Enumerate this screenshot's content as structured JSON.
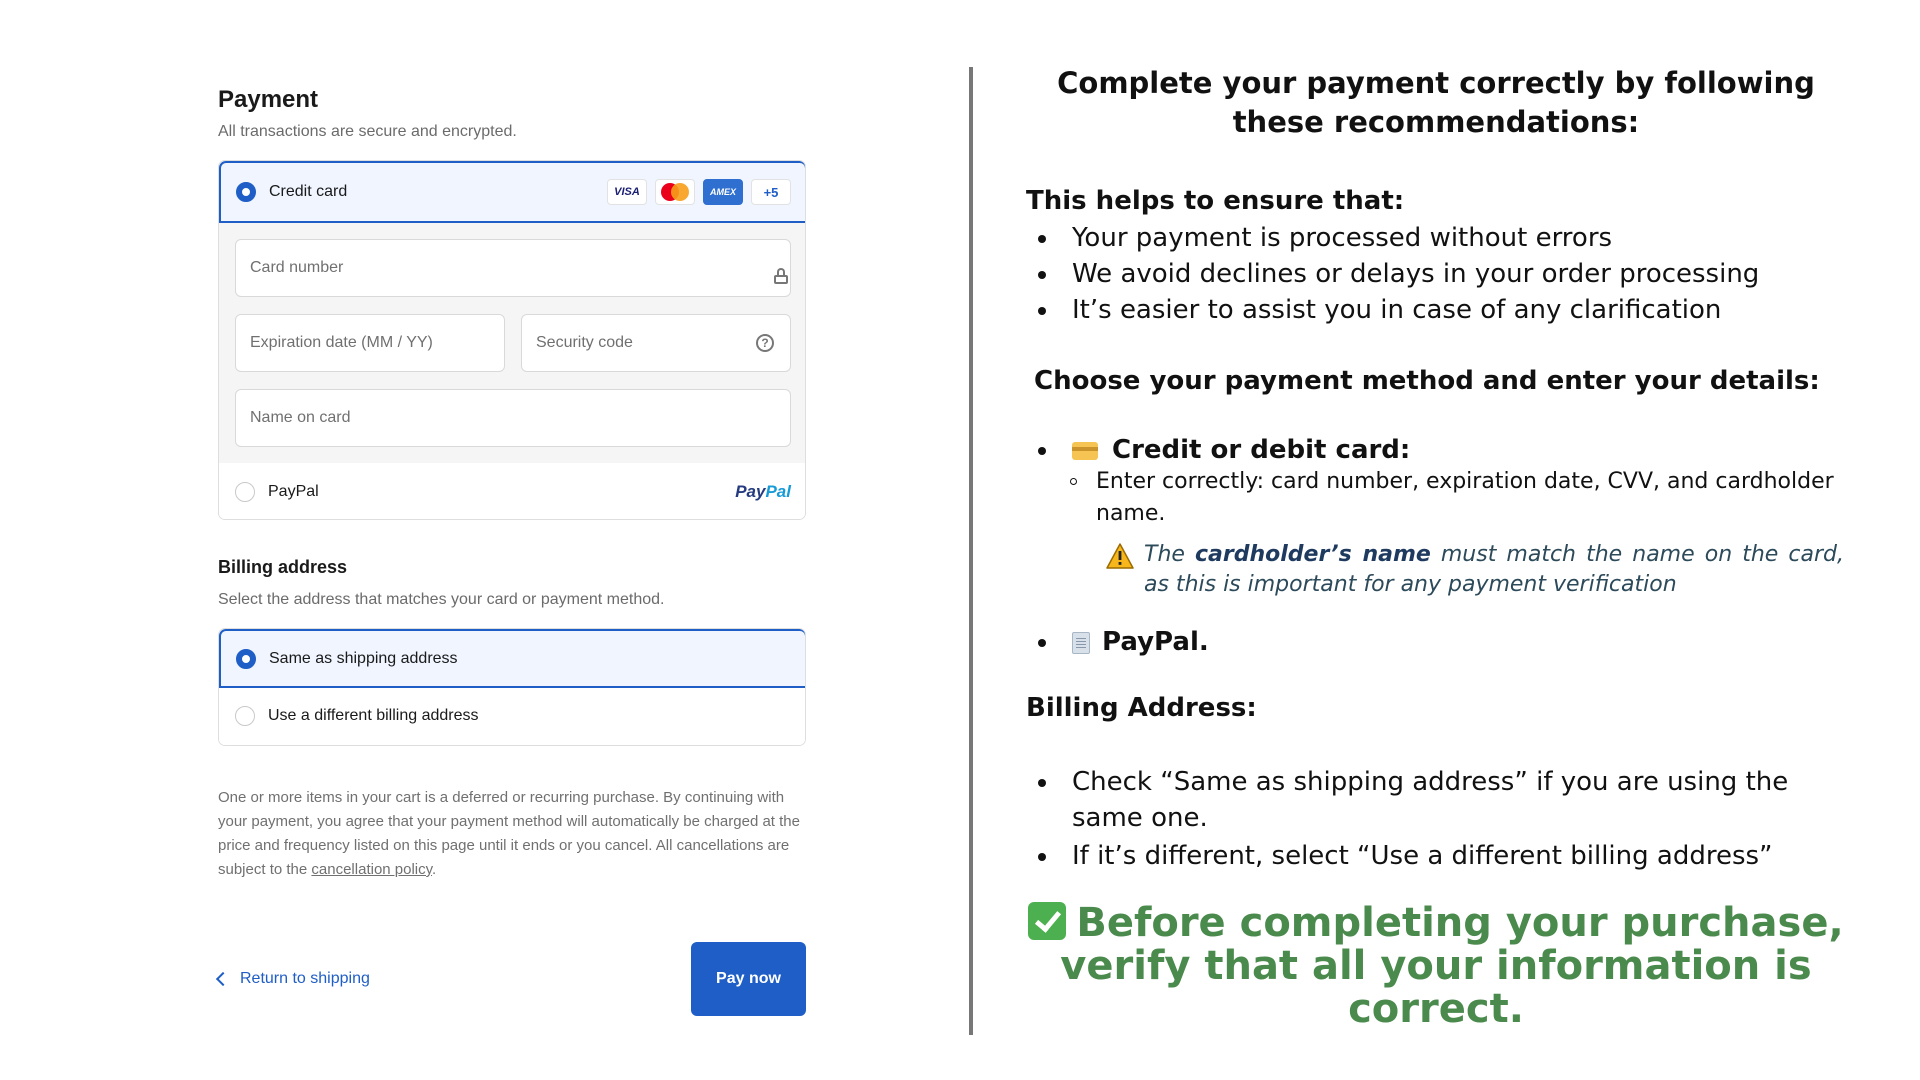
{
  "payment": {
    "title": "Payment",
    "subtitle": "All transactions are secure and encrypted.",
    "credit_card": {
      "label": "Credit card",
      "selected": true,
      "brands": [
        "VISA",
        "AMEX",
        "+5"
      ],
      "fields": {
        "card_number": "Card number",
        "expiration": "Expiration date (MM / YY)",
        "security_code": "Security code",
        "name_on_card": "Name on card"
      }
    },
    "paypal": {
      "label": "PayPal",
      "logo_a": "Pay",
      "logo_b": "Pal",
      "selected": false
    }
  },
  "billing": {
    "title": "Billing address",
    "subtitle": "Select the address that matches your card or payment method.",
    "options": [
      {
        "label": "Same as shipping address",
        "selected": true
      },
      {
        "label": "Use a different billing address",
        "selected": false
      }
    ]
  },
  "notice": {
    "text": "One or more items in your cart is a deferred or recurring purchase. By continuing with your payment, you agree that your payment method will automatically be charged at the price and frequency listed on this page until it ends or you cancel. All cancellations are subject to the ",
    "link": "cancellation policy",
    "end": "."
  },
  "footer": {
    "return_label": "Return to shipping",
    "pay_label": "Pay now"
  },
  "colors": {
    "accent": "#1f5ec6",
    "success": "#4a8a4c"
  },
  "guide": {
    "heading": "Complete your payment correctly by following these recommendations:",
    "ensure_title": "This helps to ensure that:",
    "ensure_items": [
      "Your payment is processed without errors",
      "We avoid declines or delays in your order processing",
      "It’s easier to assist you in case of any clarification"
    ],
    "choose_title": "Choose your payment method and enter your details:",
    "card_title": "Credit or debit card:",
    "card_detail": "Enter correctly: card number, expiration date, CVV, and cardholder name.",
    "warning_pre": "The ",
    "warning_bold": "cardholder’s name",
    "warning_post": " must match the name on the card, as this is important for any payment verification",
    "paypal_title": "PayPal.",
    "billing_title": "Billing Address:",
    "billing_items": [
      "Check “Same as shipping address” if you are using the same one.",
      "If it’s different, select “Use a different billing address”"
    ],
    "final": "Before completing your purchase, verify that all your information is correct."
  }
}
